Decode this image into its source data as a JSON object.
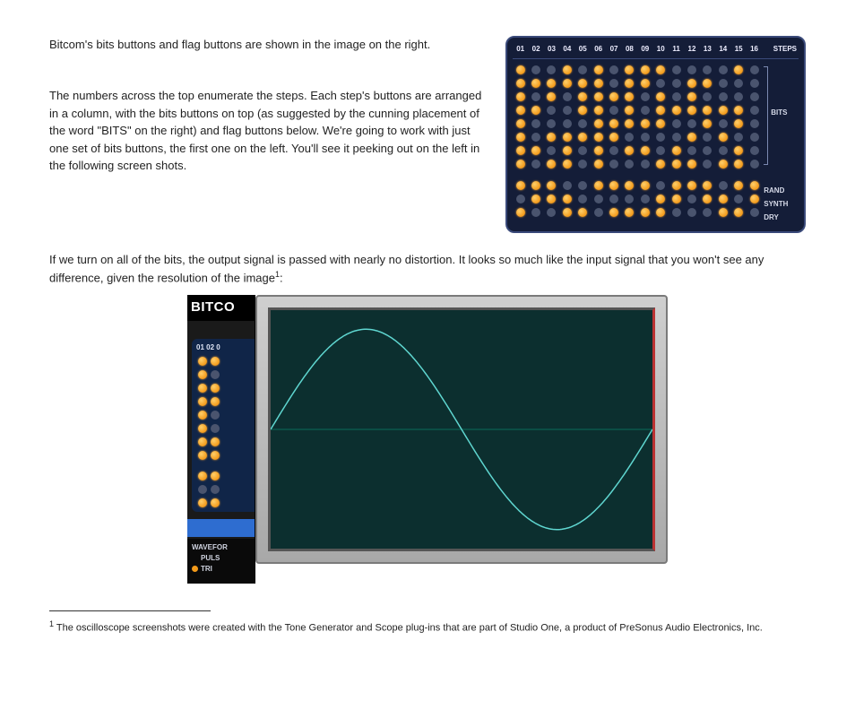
{
  "paragraphs": {
    "p1": "Bitcom's bits buttons and flag buttons are shown in the image on the right.",
    "p2": "The numbers across the top enumerate the steps. Each step's buttons are arranged in a column, with the bits buttons on top (as suggested by the cunning placement of the word \"BITS\" on the right) and flag buttons below. We're going to work with just one set of bits buttons, the first one on the left. You'll see it peeking out on the left in the following screen shots.",
    "p3": "If we turn on all of the bits, the output signal is passed with nearly no distortion. It looks so much like the input signal that you won't see any difference, given the resolution of the image",
    "p3_sup": "1",
    "p3_tail": ":"
  },
  "bit_panel": {
    "step_numbers": [
      "01",
      "02",
      "03",
      "04",
      "05",
      "06",
      "07",
      "08",
      "09",
      "10",
      "11",
      "12",
      "13",
      "14",
      "15",
      "16"
    ],
    "steps_label": "STEPS",
    "bits_label": "BITS",
    "flag_labels": [
      "RAND",
      "SYNTH",
      "DRY"
    ],
    "bits_rows": [
      [
        1,
        0,
        0,
        1,
        0,
        1,
        0,
        1,
        1,
        1,
        0,
        0,
        0,
        0,
        1,
        0
      ],
      [
        1,
        1,
        1,
        1,
        1,
        1,
        0,
        1,
        1,
        0,
        0,
        1,
        1,
        0,
        0,
        0
      ],
      [
        1,
        0,
        1,
        0,
        1,
        1,
        1,
        1,
        0,
        1,
        0,
        1,
        0,
        0,
        0,
        0
      ],
      [
        1,
        1,
        0,
        0,
        1,
        1,
        0,
        1,
        0,
        1,
        1,
        1,
        1,
        1,
        1,
        0
      ],
      [
        1,
        0,
        0,
        0,
        0,
        1,
        1,
        1,
        1,
        1,
        0,
        0,
        1,
        0,
        1,
        0
      ],
      [
        1,
        0,
        1,
        1,
        1,
        1,
        1,
        0,
        0,
        0,
        0,
        1,
        0,
        1,
        0,
        0
      ],
      [
        1,
        1,
        0,
        1,
        0,
        1,
        0,
        1,
        1,
        0,
        1,
        0,
        0,
        0,
        1,
        0
      ],
      [
        1,
        0,
        1,
        1,
        0,
        1,
        0,
        0,
        0,
        1,
        1,
        1,
        0,
        1,
        1,
        0
      ]
    ],
    "flag_rows": [
      [
        1,
        1,
        1,
        0,
        0,
        1,
        1,
        1,
        1,
        0,
        1,
        1,
        1,
        0,
        1,
        1
      ],
      [
        0,
        1,
        1,
        1,
        0,
        0,
        0,
        0,
        0,
        1,
        1,
        0,
        1,
        1,
        0,
        1
      ],
      [
        1,
        0,
        0,
        1,
        1,
        0,
        1,
        1,
        1,
        1,
        0,
        0,
        0,
        1,
        1,
        0
      ]
    ]
  },
  "bitco_strip": {
    "title": "BITCO",
    "step_nums": "01 02 0",
    "col1_bits": [
      1,
      1,
      1,
      1,
      1,
      1,
      1,
      1
    ],
    "col1_flags": [
      1,
      0,
      1
    ],
    "wavefor": "WAVEFOR",
    "puls": "PULS",
    "tri": "TRI"
  },
  "footnote": {
    "marker": "1",
    "text": " The oscilloscope screenshots were created with the Tone Generator and Scope plug-ins that are part of Studio One, a product of PreSonus Audio Electronics, Inc."
  },
  "chart_data": {
    "type": "line",
    "title": "",
    "xlabel": "",
    "ylabel": "",
    "xlim": [
      0,
      360
    ],
    "ylim": [
      -1,
      1
    ],
    "series": [
      {
        "name": "sine",
        "x": [
          0,
          30,
          60,
          90,
          120,
          150,
          180,
          210,
          240,
          270,
          300,
          330,
          360
        ],
        "values": [
          0,
          0.5,
          0.866,
          1,
          0.866,
          0.5,
          0,
          -0.5,
          -0.866,
          -1,
          -0.866,
          -0.5,
          0
        ]
      }
    ]
  }
}
